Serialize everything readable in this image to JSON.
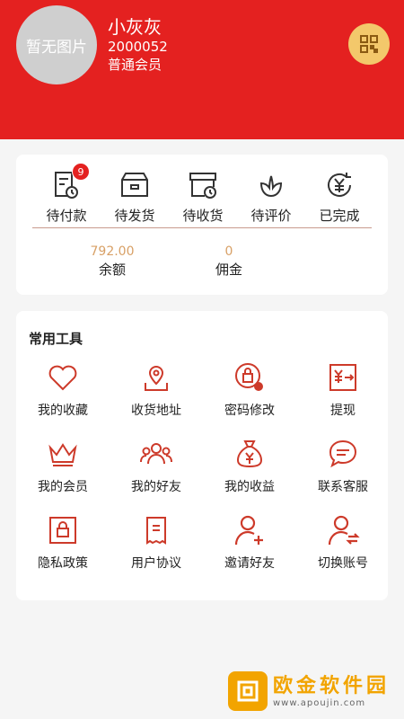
{
  "colors": {
    "brand": "#e42120",
    "accent_gold": "#f3c86b",
    "icon_red": "#cd3a2a",
    "balance_text": "#d8a066"
  },
  "user": {
    "avatar_placeholder": "暂无图片",
    "name": "小灰灰",
    "id": "2000052",
    "level": "普通会员",
    "qr_icon": "qr-code-icon"
  },
  "orders": [
    {
      "label": "待付款",
      "icon": "payment-pending-icon",
      "badge": "9"
    },
    {
      "label": "待发货",
      "icon": "box-icon"
    },
    {
      "label": "待收货",
      "icon": "box-clock-icon"
    },
    {
      "label": "待评价",
      "icon": "flower-icon"
    },
    {
      "label": "已完成",
      "icon": "yuan-refresh-icon"
    }
  ],
  "balance": [
    {
      "value": "792.00",
      "label": "余额"
    },
    {
      "value": "0",
      "label": "佣金"
    }
  ],
  "tools": {
    "title": "常用工具",
    "items": [
      {
        "label": "我的收藏",
        "icon": "heart-icon"
      },
      {
        "label": "收货地址",
        "icon": "map-pin-icon"
      },
      {
        "label": "密码修改",
        "icon": "lock-gear-icon"
      },
      {
        "label": "提现",
        "icon": "withdraw-icon"
      },
      {
        "label": "我的会员",
        "icon": "crown-icon"
      },
      {
        "label": "我的好友",
        "icon": "friends-icon"
      },
      {
        "label": "我的收益",
        "icon": "money-bag-icon"
      },
      {
        "label": "联系客服",
        "icon": "chat-bubble-icon"
      },
      {
        "label": "隐私政策",
        "icon": "privacy-lock-icon"
      },
      {
        "label": "用户协议",
        "icon": "document-icon"
      },
      {
        "label": "邀请好友",
        "icon": "user-add-icon"
      },
      {
        "label": "切换账号",
        "icon": "user-switch-icon"
      }
    ]
  },
  "watermark": {
    "brand": "欧金软件园",
    "url": "www.apoujin.com",
    "icon": "logo-icon"
  }
}
